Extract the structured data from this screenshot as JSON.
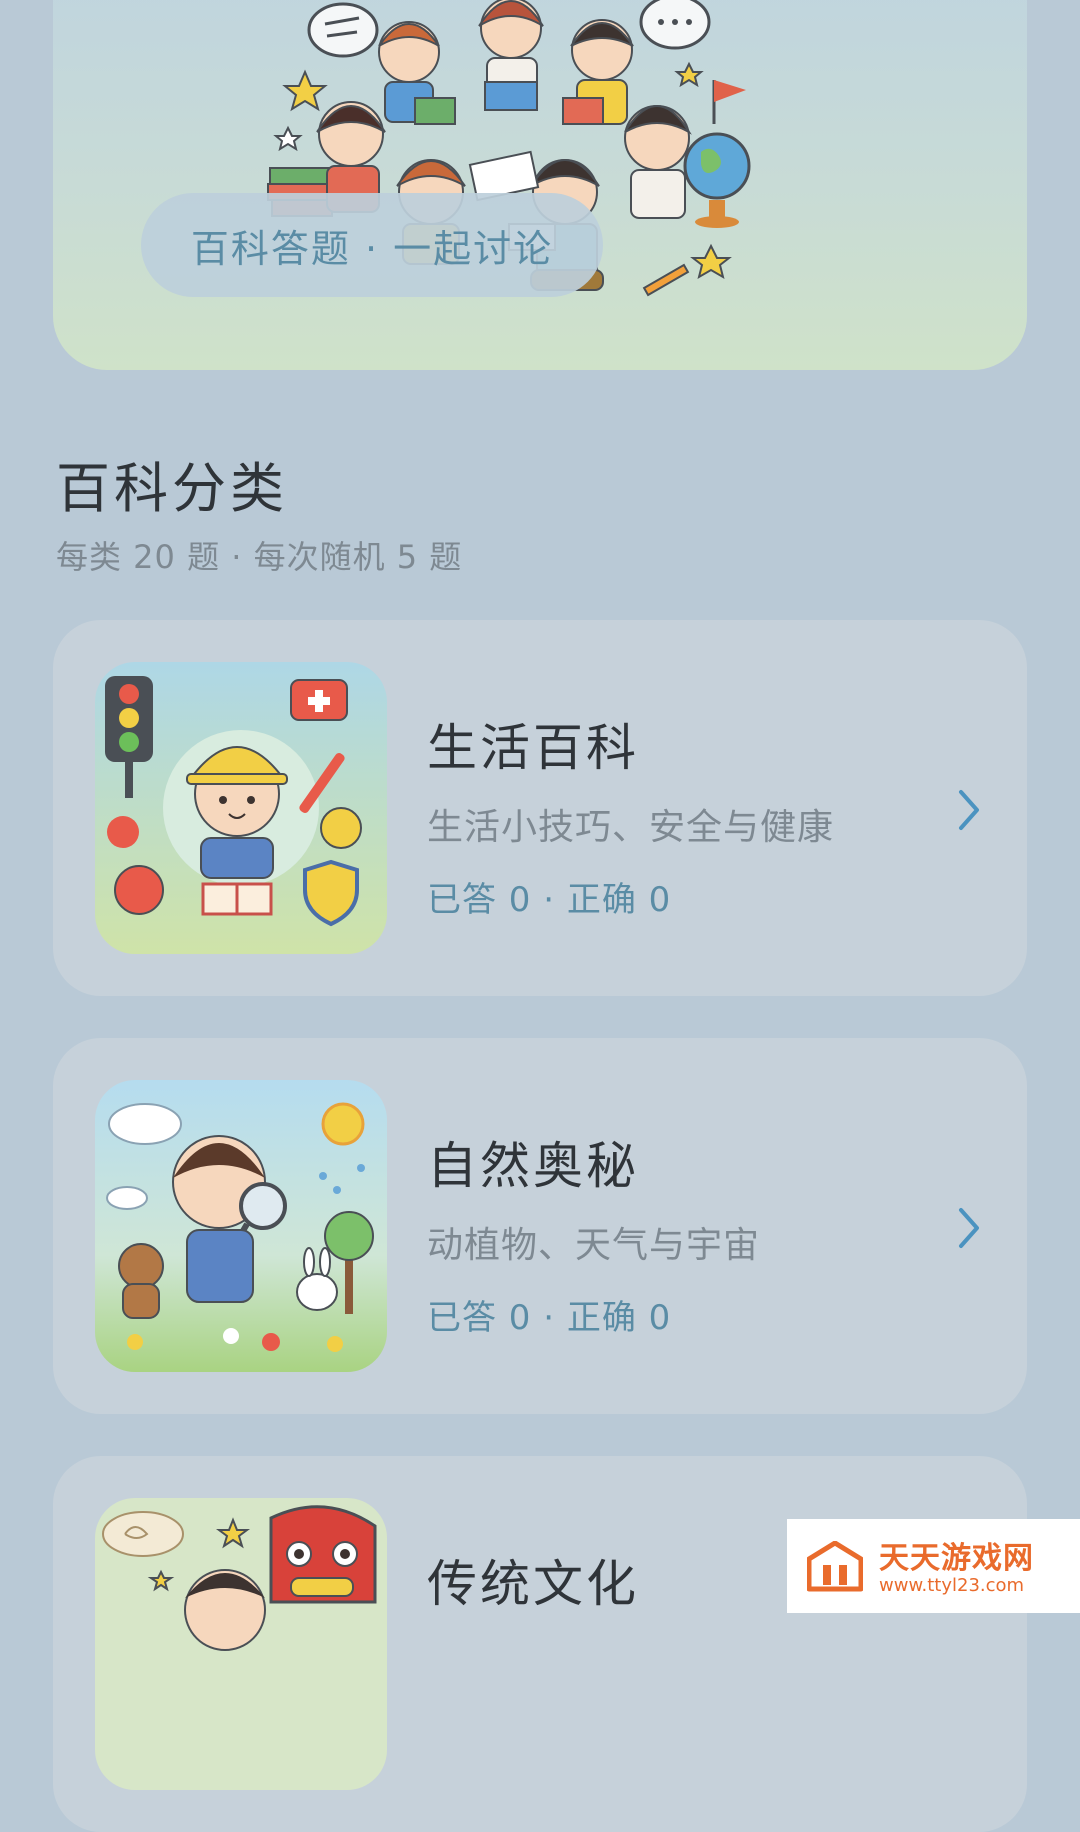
{
  "hero": {
    "tagline": "百科答题 · 一起讨论"
  },
  "section": {
    "title": "百科分类",
    "subtitle": "每类 20 题 · 每次随机 5 题"
  },
  "categories": [
    {
      "name": "生活百科",
      "desc": "生活小技巧、安全与健康",
      "stats": "已答 0 · 正确 0",
      "icon": "safety-kid-illustration"
    },
    {
      "name": "自然奥秘",
      "desc": "动植物、天气与宇宙",
      "stats": "已答 0 · 正确 0",
      "icon": "nature-explorer-illustration"
    },
    {
      "name": "传统文化",
      "icon": "lion-dance-illustration"
    }
  ],
  "watermark": {
    "name": "天天游戏网",
    "url": "www.ttyl23.com"
  },
  "colors": {
    "background": "#b9c9d6",
    "card": "#c6d1da",
    "accent": "#5a8ca5",
    "title": "#2f3439",
    "muted": "#7e8992",
    "watermark": "#e96b2c"
  }
}
